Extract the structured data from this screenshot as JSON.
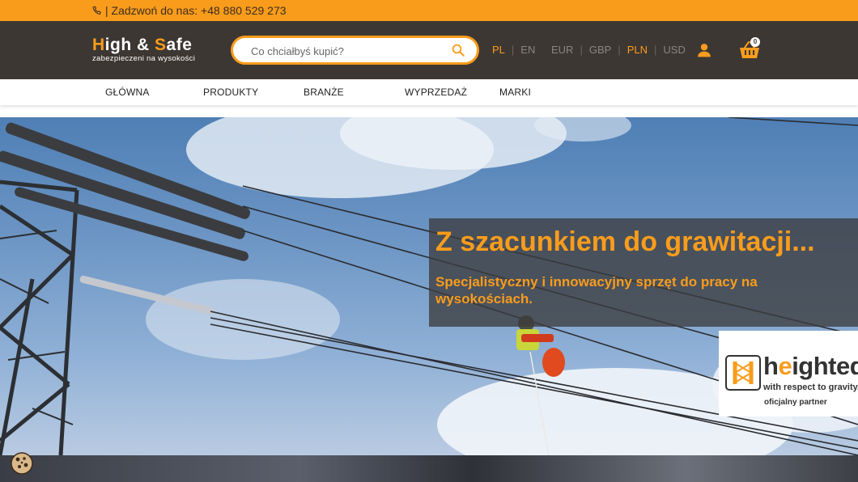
{
  "topbar": {
    "phone_text": "| Zadzwoń do nas: +48 880 529 273"
  },
  "header": {
    "logo": {
      "word1_first": "H",
      "word1_rest": "igh & ",
      "word2_first": "S",
      "word2_rest": "afe",
      "tagline": "zabezpieczeni na wysokości"
    },
    "search": {
      "placeholder": "Co chciałbyś kupić?"
    },
    "languages": [
      {
        "label": "PL",
        "active": true
      },
      {
        "label": "EN",
        "active": false
      }
    ],
    "currencies": [
      {
        "label": "EUR"
      },
      {
        "label": "GBP"
      },
      {
        "label": "PLN",
        "active": true
      },
      {
        "label": "USD"
      }
    ],
    "separator": "|",
    "cart_count": "0"
  },
  "nav": {
    "items": [
      "GŁÓWNA",
      "PRODUKTY",
      "BRANŻE",
      "WYPRZEDAŻ",
      "MARKI"
    ]
  },
  "hero": {
    "title": "Z szacunkiem do grawitacji...",
    "subtitle": "Specjalistyczny i innowacyjny sprzęt do pracy na wysokościach.",
    "partner": {
      "name_first": "h",
      "name_accent": "e",
      "name_rest": "ighteq",
      "tagline": "with respect to gravity.",
      "note": "oficjalny partner"
    }
  },
  "colors": {
    "accent": "#f99c1c",
    "header_bg": "#3d3733"
  },
  "icons": [
    "phone-icon",
    "search-icon",
    "user-icon",
    "cart-icon",
    "cookie-icon"
  ]
}
